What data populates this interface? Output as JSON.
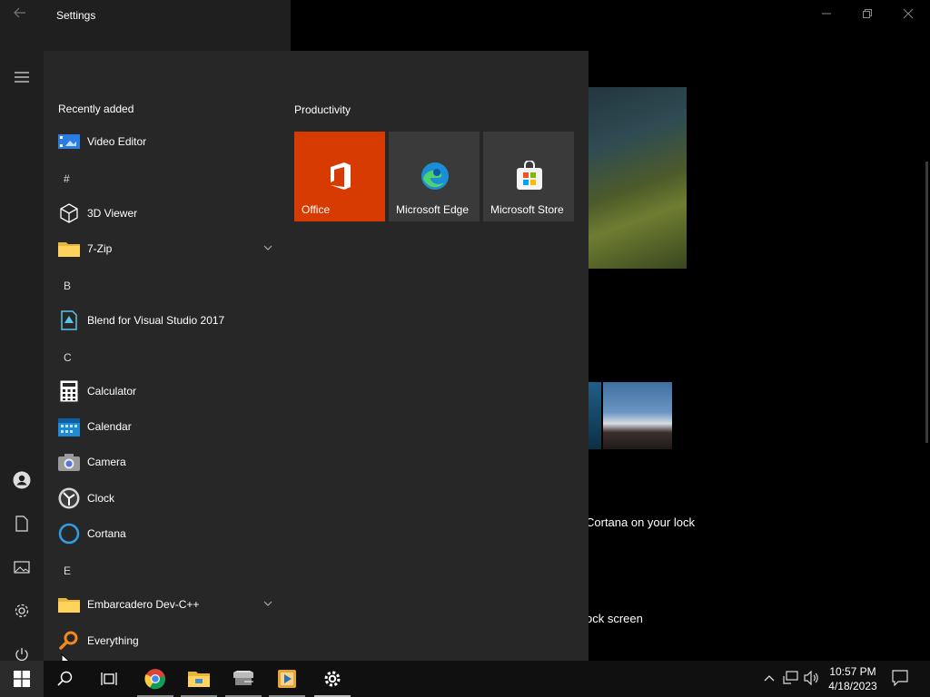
{
  "window": {
    "title": "Settings",
    "bg_text_1": "Cortana on your lock",
    "bg_text_2": "ock screen"
  },
  "start_menu": {
    "recently_added_header": "Recently added",
    "apps": [
      {
        "label": "Video Editor",
        "icon": "video-editor-icon"
      },
      {
        "label": "3D Viewer",
        "icon": "cube-icon"
      },
      {
        "label": "7-Zip",
        "icon": "folder-icon",
        "expandable": true
      },
      {
        "label": "Blend for Visual Studio 2017",
        "icon": "blend-icon"
      },
      {
        "label": "Calculator",
        "icon": "calculator-icon"
      },
      {
        "label": "Calendar",
        "icon": "calendar-icon"
      },
      {
        "label": "Camera",
        "icon": "camera-icon"
      },
      {
        "label": "Clock",
        "icon": "clock-icon"
      },
      {
        "label": "Cortana",
        "icon": "cortana-icon"
      },
      {
        "label": "Embarcadero Dev-C++",
        "icon": "folder-icon",
        "expandable": true
      },
      {
        "label": "Everything",
        "icon": "search-magnifier-icon"
      }
    ],
    "group_letters": {
      "hash": "#",
      "b": "B",
      "c": "C",
      "e": "E"
    },
    "tiles_header": "Productivity",
    "tiles": [
      {
        "label": "Office",
        "color": "#d83b01"
      },
      {
        "label": "Microsoft Edge",
        "color": "#3a3a3a"
      },
      {
        "label": "Microsoft Store",
        "color": "#3a3a3a"
      }
    ]
  },
  "taskbar": {
    "time": "10:57 PM",
    "date": "4/18/2023"
  },
  "colors": {
    "accent_office": "#d83b01",
    "start_bg": "#272727",
    "taskbar_bg": "#101010"
  }
}
